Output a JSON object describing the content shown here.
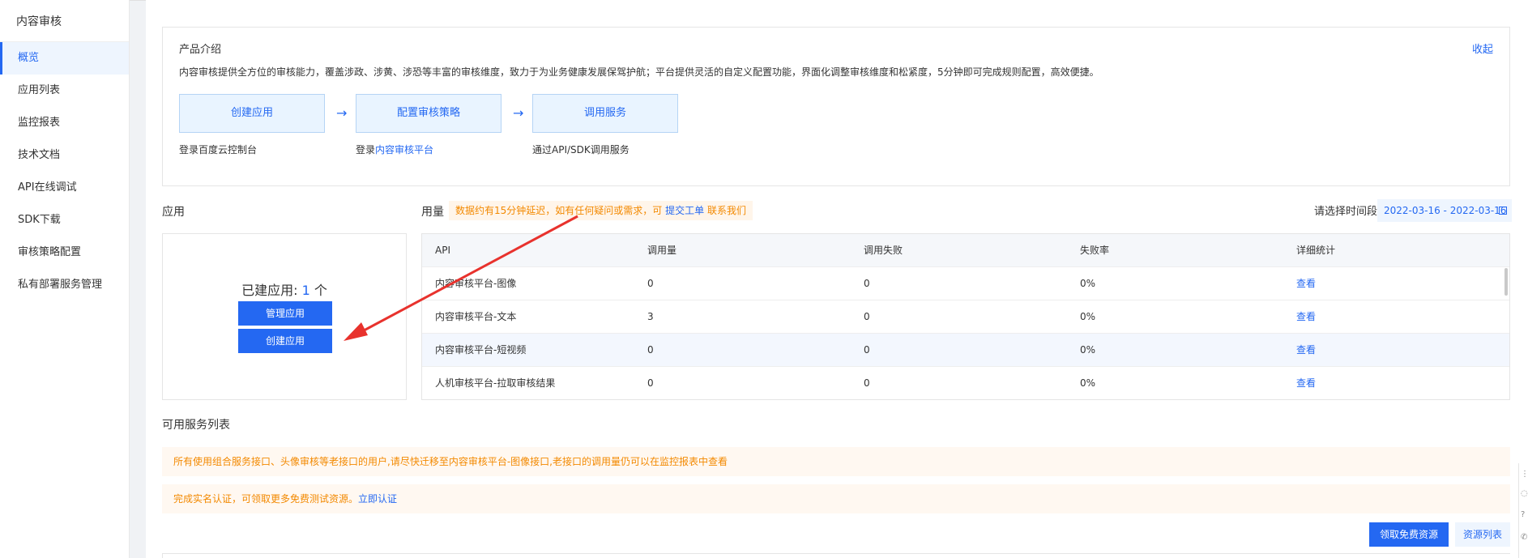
{
  "sidebar": {
    "title": "内容审核",
    "items": [
      {
        "label": "概览",
        "active": true
      },
      {
        "label": "应用列表"
      },
      {
        "label": "监控报表"
      },
      {
        "label": "技术文档"
      },
      {
        "label": "API在线调试"
      },
      {
        "label": "SDK下载"
      },
      {
        "label": "审核策略配置"
      },
      {
        "label": "私有部署服务管理"
      }
    ]
  },
  "intro": {
    "title": "产品介绍",
    "collapse": "收起",
    "description": "内容审核提供全方位的审核能力，覆盖涉政、涉黄、涉恐等丰富的审核维度，致力于为业务健康发展保驾护航；平台提供灵活的自定义配置功能，界面化调整审核维度和松紧度，5分钟即可完成规则配置，高效便捷。",
    "steps": [
      {
        "label": "创建应用",
        "sub": "登录百度云控制台"
      },
      {
        "label": "配置审核策略",
        "sub_prefix": "登录",
        "sub_link": "内容审核平台"
      },
      {
        "label": "调用服务",
        "sub": "通过API/SDK调用服务"
      }
    ],
    "arrow": "→"
  },
  "apps": {
    "title": "应用",
    "created_prefix": "已建应用: ",
    "created_count": "1",
    "created_suffix": " 个",
    "manage_button": "管理应用",
    "create_button": "创建应用"
  },
  "usage": {
    "title": "用量",
    "tip_text": "数据约有15分钟延迟，如有任何疑问或需求，可",
    "tip_link": "提交工单",
    "tip_suffix": "联系我们",
    "date_label": "请选择时间段",
    "date_range": "2022-03-16 - 2022-03-16",
    "columns": [
      "API",
      "调用量",
      "调用失败",
      "失败率",
      "详细统计"
    ],
    "rows": [
      {
        "api": "内容审核平台-图像",
        "calls": "0",
        "failed": "0",
        "rate": "0%",
        "detail": "查看"
      },
      {
        "api": "内容审核平台-文本",
        "calls": "3",
        "failed": "0",
        "rate": "0%",
        "detail": "查看"
      },
      {
        "api": "内容审核平台-短视频",
        "calls": "0",
        "failed": "0",
        "rate": "0%",
        "detail": "查看"
      },
      {
        "api": "人机审核平台-拉取审核结果",
        "calls": "0",
        "failed": "0",
        "rate": "0%",
        "detail": "查看"
      }
    ]
  },
  "services": {
    "title": "可用服务列表",
    "notice1": "所有使用组合服务接口、头像审核等老接口的用户,请尽快迁移至内容审核平台-图像接口,老接口的调用量仍可以在监控报表中查看",
    "notice2_text": "完成实名认证，可领取更多免费测试资源。",
    "notice2_link": "立即认证",
    "free_button": "领取免费资源",
    "resource_button": "资源列表"
  },
  "colors": {
    "accent": "#2468f2",
    "warning": "#f38900",
    "annotation": "#e8322d"
  }
}
